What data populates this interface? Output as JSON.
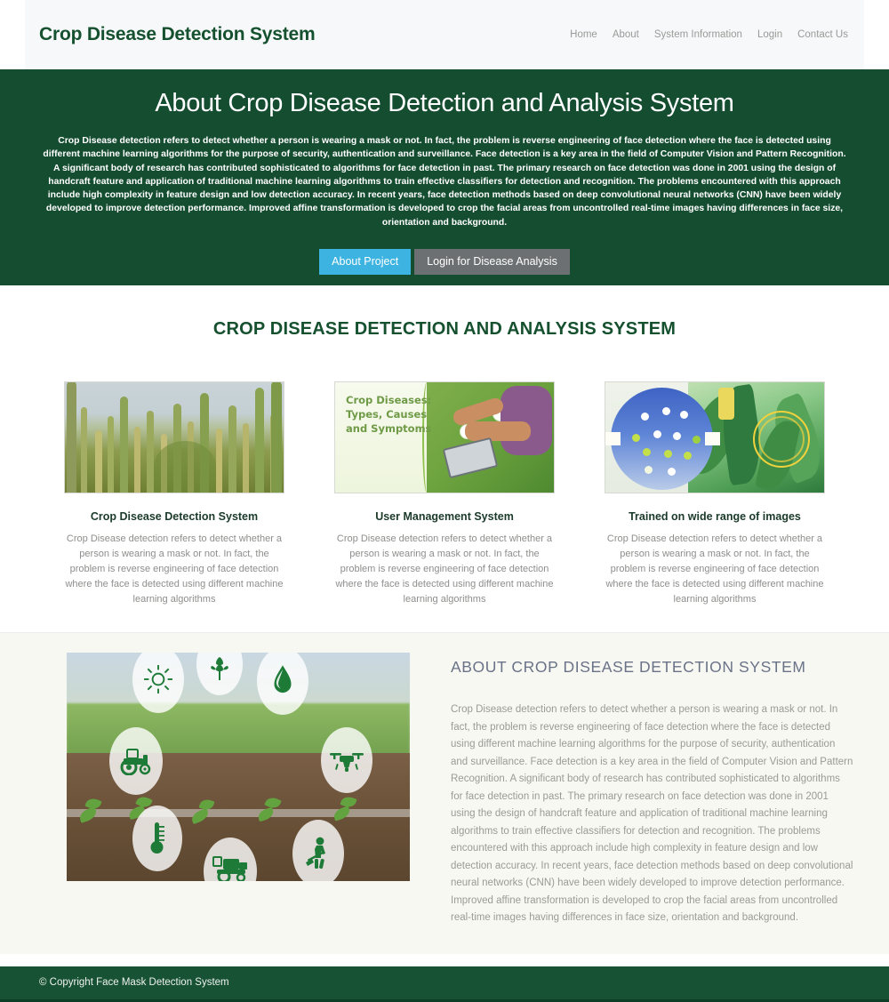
{
  "header": {
    "brand": "Crop Disease Detection System",
    "nav": [
      {
        "label": "Home",
        "name": "nav-home"
      },
      {
        "label": "About",
        "name": "nav-about"
      },
      {
        "label": "System Information",
        "name": "nav-system-information"
      },
      {
        "label": "Login",
        "name": "nav-login"
      },
      {
        "label": "Contact Us",
        "name": "nav-contact-us"
      }
    ]
  },
  "hero": {
    "title": "About Crop Disease Detection and Analysis System",
    "paragraph": "Crop Disease detection refers to detect whether a person is wearing a mask or not. In fact, the problem is reverse engineering of face detection where the face is detected using different machine learning algorithms for the purpose of security, authentication and surveillance. Face detection is a key area in the field of Computer Vision and Pattern Recognition. A significant body of research has contributed sophisticated to algorithms for face detection in past. The primary research on face detection was done in 2001 using the design of handcraft feature and application of traditional machine learning algorithms to train effective classifiers for detection and recognition. The problems encountered with this approach include high complexity in feature design and low detection accuracy. In recent years, face detection methods based on deep convolutional neural networks (CNN) have been widely developed to improve detection performance. Improved affine transformation is developed to crop the facial areas from uncontrolled real-time images having differences in face size, orientation and background.",
    "primary_button": "About Project",
    "secondary_button": "Login for Disease Analysis"
  },
  "features": {
    "section_title": "CROP DISEASE DETECTION AND ANALYSIS SYSTEM",
    "cards": [
      {
        "title": "Crop Disease Detection System",
        "text": "Crop Disease detection refers to detect whether a person is wearing a mask or not. In fact, the problem is reverse engineering of face detection where the face is detected using different machine learning algorithms",
        "image_name": "millet-crop-field-photo"
      },
      {
        "title": "User Management System",
        "text": "Crop Disease detection refers to detect whether a person is wearing a mask or not. In fact, the problem is reverse engineering of face detection where the face is detected using different machine learning algorithms",
        "image_name": "crop-diseases-banner",
        "image_caption": "Crop Diseases: Types, Causes and Symptoms"
      },
      {
        "title": "Trained on wide range of images",
        "text": "Crop Disease detection refers to detect whether a person is wearing a mask or not. In fact, the problem is reverse engineering of face detection where the face is detected using different machine learning algorithms",
        "image_name": "neural-network-corn-illustration"
      }
    ]
  },
  "about": {
    "title": "ABOUT CROP DISEASE DETECTION SYSTEM",
    "text": "Crop Disease detection refers to detect whether a person is wearing a mask or not. In fact, the problem is reverse engineering of face detection where the face is detected using different machine learning algorithms for the purpose of security, authentication and surveillance. Face detection is a key area in the field of Computer Vision and Pattern Recognition. A significant body of research has contributed sophisticated to algorithms for face detection in past. The primary research on face detection was done in 2001 using the design of handcraft feature and application of traditional machine learning algorithms to train effective classifiers for detection and recognition. The problems encountered with this approach include high complexity in feature design and low detection accuracy. In recent years, face detection methods based on deep convolutional neural networks (CNN) have been widely developed to improve detection performance. Improved affine transformation is developed to crop the facial areas from uncontrolled real-time images having differences in face size, orientation and background.",
    "image_name": "smart-agriculture-icons-photo",
    "image_icons": [
      "sun-icon",
      "wheat-icon",
      "water-drop-icon",
      "tractor-icon",
      "drone-icon",
      "thermometer-icon",
      "harvester-icon",
      "farmer-shovel-icon"
    ]
  },
  "footer": {
    "copyright": "© Copyright Face Mask Detection System"
  },
  "colors": {
    "brand_green": "#154d31",
    "footer_green": "#165233",
    "primary_button": "#3cb3e0",
    "secondary_button": "#6d7073",
    "about_heading": "#6a7288",
    "header_bg": "#f6f8f9",
    "about_bg": "#f8f8f2"
  }
}
